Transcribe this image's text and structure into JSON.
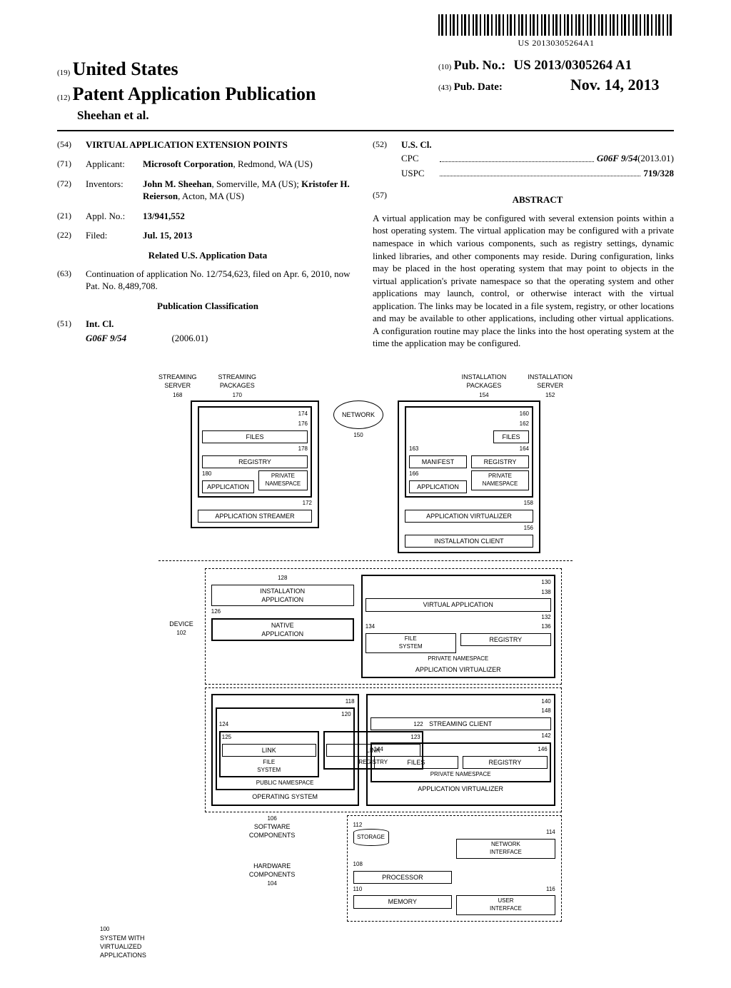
{
  "barcode_text": "US 20130305264A1",
  "header": {
    "code19": "(19)",
    "country": "United States",
    "code12": "(12)",
    "pub_type": "Patent Application Publication",
    "authors": "Sheehan et al.",
    "code10": "(10)",
    "pub_no_label": "Pub. No.:",
    "pub_no": "US 2013/0305264 A1",
    "code43": "(43)",
    "pub_date_label": "Pub. Date:",
    "pub_date": "Nov. 14, 2013"
  },
  "bib": {
    "c54": "(54)",
    "title": "VIRTUAL APPLICATION EXTENSION POINTS",
    "c71": "(71)",
    "applicant_label": "Applicant:",
    "applicant": "Microsoft Corporation, Redmond, WA (US)",
    "applicant_bold": "Microsoft Corporation",
    "applicant_rest": ", Redmond, WA (US)",
    "c72": "(72)",
    "inventors_label": "Inventors:",
    "inv1_bold": "John M. Sheehan",
    "inv1_rest": ", Somerville, MA (US); ",
    "inv2_bold": "Kristofer H. Reierson",
    "inv2_rest": ", Acton, MA (US)",
    "c21": "(21)",
    "appl_no_label": "Appl. No.:",
    "appl_no": "13/941,552",
    "c22": "(22)",
    "filed_label": "Filed:",
    "filed": "Jul. 15, 2013",
    "related_heading": "Related U.S. Application Data",
    "c63": "(63)",
    "continuation": "Continuation of application No. 12/754,623, filed on Apr. 6, 2010, now Pat. No. 8,489,708.",
    "pub_class_heading": "Publication Classification",
    "c51": "(51)",
    "intcl_label": "Int. Cl.",
    "intcl_code": "G06F 9/54",
    "intcl_ver": "(2006.01)",
    "c52": "(52)",
    "uscl_label": "U.S. Cl.",
    "cpc_label": "CPC",
    "cpc_val": "G06F 9/54",
    "cpc_ver": " (2013.01)",
    "uspc_label": "USPC",
    "uspc_val": "719/328",
    "c57": "(57)",
    "abstract_heading": "ABSTRACT",
    "abstract_text": "A virtual application may be configured with several extension points within a host operating system. The virtual application may be configured with a private namespace in which various components, such as registry settings, dynamic linked libraries, and other components may reside. During configuration, links may be placed in the host operating system that may point to objects in the virtual application's private namespace so that the operating system and other applications may launch, control, or otherwise interact with the virtual application. The links may be located in a file system, registry, or other locations and may be available to other applications, including other virtual applications. A configuration routine may place the links into the host operating system at the time the application may be configured."
  },
  "figure": {
    "streaming_server": "STREAMING\nSERVER",
    "r168": "168",
    "streaming_packages": "STREAMING\nPACKAGES",
    "r170": "170",
    "installation_packages": "INSTALLATION\nPACKAGES",
    "r154": "154",
    "installation_server": "INSTALLATION\nSERVER",
    "r152": "152",
    "r174": "174",
    "r176": "176",
    "files": "FILES",
    "r178": "178",
    "registry": "REGISTRY",
    "r180": "180",
    "application": "APPLICATION",
    "private_namespace": "PRIVATE\nNAMESPACE",
    "r172": "172",
    "application_streamer": "APPLICATION STREAMER",
    "network": "NETWORK",
    "r150": "150",
    "r160": "160",
    "r162": "162",
    "r163": "163",
    "manifest": "MANIFEST",
    "r164": "164",
    "r166": "166",
    "r158": "158",
    "application_virtualizer": "APPLICATION VIRTUALIZER",
    "r156": "156",
    "installation_client": "INSTALLATION CLIENT",
    "device": "DEVICE",
    "r102": "102",
    "r128": "128",
    "installation_application": "INSTALLATION\nAPPLICATION",
    "r126": "126",
    "native_application": "NATIVE\nAPPLICATION",
    "r130": "130",
    "r138": "138",
    "virtual_application": "VIRTUAL APPLICATION",
    "r132": "132",
    "r134": "134",
    "file_system": "FILE\nSYSTEM",
    "r136": "136",
    "r118": "118",
    "r120": "120",
    "r124": "124",
    "r125": "125",
    "r122": "122",
    "r123": "123",
    "link": "LINK",
    "public_namespace": "PUBLIC NAMESPACE",
    "operating_system": "OPERATING SYSTEM",
    "r140": "140",
    "r148": "148",
    "streaming_client": "STREAMING CLIENT",
    "r142": "142",
    "r144": "144",
    "r146": "146",
    "r106": "106",
    "software_components": "SOFTWARE\nCOMPONENTS",
    "r112": "112",
    "storage": "STORAGE",
    "r114": "114",
    "network_interface": "NETWORK\nINTERFACE",
    "r108": "108",
    "processor": "PROCESSOR",
    "hardware_components": "HARDWARE\nCOMPONENTS",
    "r104": "104",
    "r110": "110",
    "memory": "MEMORY",
    "r116": "116",
    "user_interface": "USER\nINTERFACE",
    "r100": "100",
    "system_caption": "SYSTEM WITH\nVIRTUALIZED\nAPPLICATIONS"
  }
}
